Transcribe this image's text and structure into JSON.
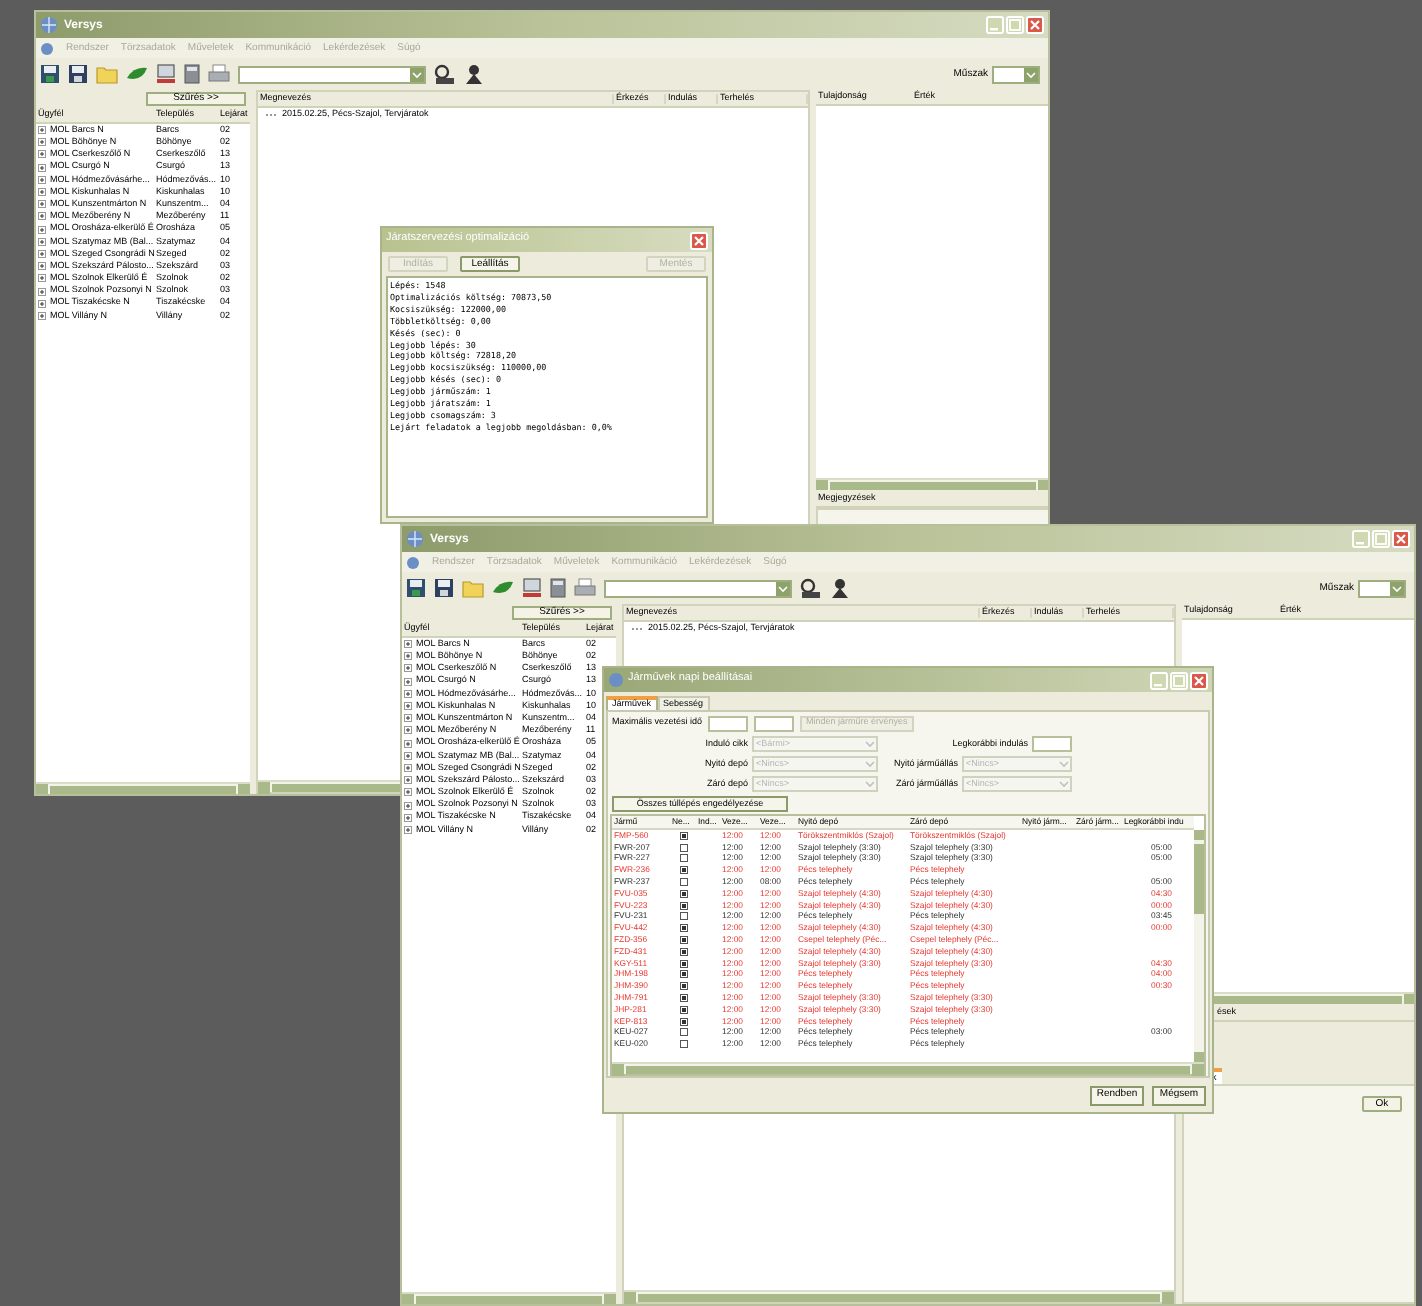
{
  "windows": [
    {
      "title": "Versys",
      "menu": [
        "Rendszer",
        "Törzsadatok",
        "Műveletek",
        "Kommunikáció",
        "Lekérdezések",
        "Súgó"
      ],
      "shift_label": "Műszak",
      "filter_button": "Szűrés >>",
      "clients": {
        "columns": [
          "Ügyfél",
          "Település",
          "Lejárat"
        ],
        "rows": [
          [
            "MOL Barcs N",
            "Barcs",
            "02"
          ],
          [
            "MOL Böhönye N",
            "Böhönye",
            "02"
          ],
          [
            "MOL Cserkeszőlő N",
            "Cserkeszőlő",
            "13"
          ],
          [
            "MOL Csurgó N",
            "Csurgó",
            "13"
          ],
          [
            "MOL Hódmezővásárhe...",
            "Hódmezővás...",
            "10"
          ],
          [
            "MOL Kiskunhalas N",
            "Kiskunhalas",
            "10"
          ],
          [
            "MOL Kunszentmárton N",
            "Kunszentm...",
            "04"
          ],
          [
            "MOL Mezőberény N",
            "Mezőberény",
            "11"
          ],
          [
            "MOL Orosháza-elkerülő É",
            "Orosháza",
            "05"
          ],
          [
            "MOL Szatymaz MB (Bal...",
            "Szatymaz",
            "04"
          ],
          [
            "MOL Szeged Csongrádi N",
            "Szeged",
            "02"
          ],
          [
            "MOL Szekszárd Pálosto...",
            "Szekszárd",
            "03"
          ],
          [
            "MOL Szolnok Elkerülő É",
            "Szolnok",
            "02"
          ],
          [
            "MOL Szolnok Pozsonyi N",
            "Szolnok",
            "03"
          ],
          [
            "MOL Tiszakécske N",
            "Tiszakécske",
            "04"
          ],
          [
            "MOL Villány N",
            "Villány",
            "02"
          ]
        ]
      },
      "tasks": {
        "columns": [
          "Megnevezés",
          "Érkezés",
          "Indulás",
          "Terhelés"
        ],
        "rows": [
          "2015.02.25, Pécs-Szajol, Tervjáratok"
        ]
      },
      "properties": {
        "columns": [
          "Tulajdonság",
          "Érték"
        ]
      },
      "notes_tab": "Megjegyzések"
    },
    {
      "title": "Versys",
      "menu": [
        "Rendszer",
        "Törzsadatok",
        "Műveletek",
        "Kommunikáció",
        "Lekérdezések",
        "Súgó"
      ],
      "shift_label": "Műszak",
      "filter_button": "Szűrés >>",
      "clients": {
        "columns": [
          "Ügyfél",
          "Település",
          "Lejárat"
        ],
        "rows": [
          [
            "MOL Barcs N",
            "Barcs",
            "02"
          ],
          [
            "MOL Böhönye N",
            "Böhönye",
            "02"
          ],
          [
            "MOL Cserkeszőlő N",
            "Cserkeszőlő",
            "13"
          ],
          [
            "MOL Csurgó N",
            "Csurgó",
            "13"
          ],
          [
            "MOL Hódmezővásárhe...",
            "Hódmezővás...",
            "10"
          ],
          [
            "MOL Kiskunhalas N",
            "Kiskunhalas",
            "10"
          ],
          [
            "MOL Kunszentmárton N",
            "Kunszentm...",
            "04"
          ],
          [
            "MOL Mezőberény N",
            "Mezőberény",
            "11"
          ],
          [
            "MOL Orosháza-elkerülő É",
            "Orosháza",
            "05"
          ],
          [
            "MOL Szatymaz MB (Bal...",
            "Szatymaz",
            "04"
          ],
          [
            "MOL Szeged Csongrádi N",
            "Szeged",
            "02"
          ],
          [
            "MOL Szekszárd Pálosto...",
            "Szekszárd",
            "03"
          ],
          [
            "MOL Szolnok Elkerülő É",
            "Szolnok",
            "02"
          ],
          [
            "MOL Szolnok Pozsonyi N",
            "Szolnok",
            "03"
          ],
          [
            "MOL Tiszakécske N",
            "Tiszakécske",
            "04"
          ],
          [
            "MOL Villány N",
            "Villány",
            "02"
          ]
        ]
      },
      "tasks": {
        "columns": [
          "Megnevezés",
          "Érkezés",
          "Indulás",
          "Terhelés"
        ],
        "rows": [
          "2015.02.25, Pécs-Szajol, Tervjáratok"
        ]
      },
      "properties": {
        "columns": [
          "Tulajdonság",
          "Érték"
        ]
      },
      "notes_tab": "ések",
      "sub_tab": "k",
      "ok_button": "Ok"
    }
  ],
  "optimization_dialog": {
    "title": "Járatszervezési optimalizáció",
    "buttons": [
      {
        "label": "Indítás",
        "disabled": true
      },
      {
        "label": "Leállítás",
        "disabled": false
      },
      {
        "label": "Mentés",
        "disabled": true
      }
    ],
    "log": [
      "Lépés: 1548",
      "Optimalizációs költség: 70873,50",
      "Kocsiszükség: 122000,00",
      "Többletköltség: 0,00",
      "Késés (sec): 0",
      "Legjobb lépés: 30",
      "Legjobb költség: 72818,20",
      "Legjobb kocsiszükség: 110000,00",
      "Legjobb késés (sec): 0",
      "Legjobb járműszám: 1",
      "Legjobb járatszám: 1",
      "Legjobb csomagszám: 3",
      "Lejárt feladatok a legjobb megoldásban: 0,0%"
    ]
  },
  "vehicle_dialog": {
    "title": "Járművek napi beállításai",
    "tabs": [
      {
        "label": "Járművek",
        "selected": true
      },
      {
        "label": "Sebesség",
        "selected": false
      }
    ],
    "max_driving_label": "Maximális vezetési idő",
    "apply_all_button": {
      "label": "Minden járműre érvényes",
      "disabled": true
    },
    "start_cycle": {
      "label": "Induló cikk",
      "placeholder": "<Bármi>"
    },
    "earliest_start_label": "Legkorábbi indulás",
    "opening_depot": {
      "label": "Nyitó depó",
      "placeholder": "<Nincs>"
    },
    "opening_stand": {
      "label": "Nyitó járműállás",
      "placeholder": "<Nincs>"
    },
    "closing_depot": {
      "label": "Záró depó",
      "placeholder": "<Nincs>"
    },
    "closing_stand": {
      "label": "Záró járműállás",
      "placeholder": "<Nincs>"
    },
    "allow_all_button": "Összes túllépés engedélyezése",
    "columns": [
      "Jármű",
      "Ne...",
      "Ind...",
      "Veze...",
      "Veze...",
      "Nyitó depó",
      "Záró depó",
      "Nyitó járm...",
      "Záró járm...",
      "Legkorábbi indu"
    ],
    "rows": [
      {
        "vehicle": "FMP-560",
        "checked": true,
        "warning": true,
        "drive_1": "12:00",
        "drive_2": "12:00",
        "opening_depot": "Törökszentmiklós (Szajol)",
        "closing_depot": "Törökszentmiklós (Szajol)"
      },
      {
        "vehicle": "FWR-207",
        "checked": false,
        "warning": false,
        "drive_1": "12:00",
        "drive_2": "12:00",
        "opening_depot": "Szajol telephely (3:30)",
        "closing_depot": "Szajol telephely (3:30)",
        "earliest": "05:00"
      },
      {
        "vehicle": "FWR-227",
        "checked": false,
        "warning": false,
        "drive_1": "12:00",
        "drive_2": "12:00",
        "opening_depot": "Szajol telephely (3:30)",
        "closing_depot": "Szajol telephely (3:30)",
        "earliest": "05:00"
      },
      {
        "vehicle": "FWR-236",
        "checked": true,
        "warning": true,
        "drive_1": "12:00",
        "drive_2": "12:00",
        "opening_depot": "Pécs telephely",
        "closing_depot": "Pécs telephely"
      },
      {
        "vehicle": "FWR-237",
        "checked": false,
        "warning": false,
        "drive_1": "12:00",
        "drive_2": "08:00",
        "opening_depot": "Pécs telephely",
        "closing_depot": "Pécs telephely",
        "earliest": "05:00"
      },
      {
        "vehicle": "FVU-035",
        "checked": true,
        "warning": true,
        "drive_1": "12:00",
        "drive_2": "12:00",
        "opening_depot": "Szajol telephely (4:30)",
        "closing_depot": "Szajol telephely (4:30)",
        "earliest": "04:30"
      },
      {
        "vehicle": "FVU-223",
        "checked": true,
        "warning": true,
        "drive_1": "12:00",
        "drive_2": "12:00",
        "opening_depot": "Szajol telephely (4:30)",
        "closing_depot": "Szajol telephely (4:30)",
        "earliest": "00:00"
      },
      {
        "vehicle": "FVU-231",
        "checked": false,
        "warning": false,
        "drive_1": "12:00",
        "drive_2": "12:00",
        "opening_depot": "Pécs telephely",
        "closing_depot": "Pécs telephely",
        "earliest": "03:45"
      },
      {
        "vehicle": "FVU-442",
        "checked": true,
        "warning": true,
        "drive_1": "12:00",
        "drive_2": "12:00",
        "opening_depot": "Szajol telephely (4:30)",
        "closing_depot": "Szajol telephely (4:30)",
        "earliest": "00:00"
      },
      {
        "vehicle": "FZD-356",
        "checked": true,
        "warning": true,
        "drive_1": "12:00",
        "drive_2": "12:00",
        "opening_depot": "Csepel telephely (Péc...",
        "closing_depot": "Csepel telephely (Péc..."
      },
      {
        "vehicle": "FZD-431",
        "checked": true,
        "warning": true,
        "drive_1": "12:00",
        "drive_2": "12:00",
        "opening_depot": "Szajol telephely (4:30)",
        "closing_depot": "Szajol telephely (4:30)"
      },
      {
        "vehicle": "KGY-511",
        "checked": true,
        "warning": true,
        "drive_1": "12:00",
        "drive_2": "12:00",
        "opening_depot": "Szajol telephely (3:30)",
        "closing_depot": "Szajol telephely (3:30)",
        "earliest": "04:30"
      },
      {
        "vehicle": "JHM-198",
        "checked": true,
        "warning": true,
        "drive_1": "12:00",
        "drive_2": "12:00",
        "opening_depot": "Pécs telephely",
        "closing_depot": "Pécs telephely",
        "earliest": "04:00"
      },
      {
        "vehicle": "JHM-390",
        "checked": true,
        "warning": true,
        "drive_1": "12:00",
        "drive_2": "12:00",
        "opening_depot": "Pécs telephely",
        "closing_depot": "Pécs telephely",
        "earliest": "00:30"
      },
      {
        "vehicle": "JHM-791",
        "checked": true,
        "warning": true,
        "drive_1": "12:00",
        "drive_2": "12:00",
        "opening_depot": "Szajol telephely (3:30)",
        "closing_depot": "Szajol telephely (3:30)"
      },
      {
        "vehicle": "JHP-281",
        "checked": true,
        "warning": true,
        "drive_1": "12:00",
        "drive_2": "12:00",
        "opening_depot": "Szajol telephely (3:30)",
        "closing_depot": "Szajol telephely (3:30)"
      },
      {
        "vehicle": "KEP-813",
        "checked": true,
        "warning": true,
        "drive_1": "12:00",
        "drive_2": "12:00",
        "opening_depot": "Pécs telephely",
        "closing_depot": "Pécs telephely"
      },
      {
        "vehicle": "KEU-027",
        "checked": false,
        "warning": false,
        "drive_1": "12:00",
        "drive_2": "12:00",
        "opening_depot": "Pécs telephely",
        "closing_depot": "Pécs telephely",
        "earliest": "03:00"
      },
      {
        "vehicle": "KEU-020",
        "checked": false,
        "warning": false,
        "drive_1": "12:00",
        "drive_2": "12:00",
        "opening_depot": "Pécs telephely",
        "closing_depot": "Pécs telephely"
      }
    ],
    "ok_button": "Rendben",
    "cancel_button": "Mégsem"
  }
}
